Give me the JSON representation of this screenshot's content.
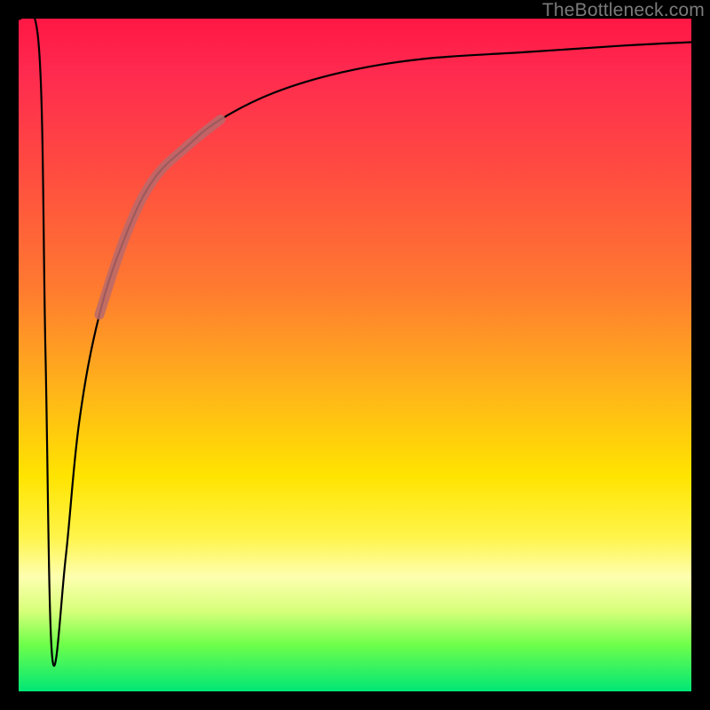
{
  "watermark": "TheBottleneck.com",
  "chart_data": {
    "type": "line",
    "title": "",
    "xlabel": "",
    "ylabel": "",
    "xlim": [
      0,
      100
    ],
    "ylim": [
      0,
      100
    ],
    "curve": {
      "x": [
        0,
        3,
        4,
        5,
        7,
        9,
        12,
        16,
        20,
        25,
        30,
        38,
        48,
        60,
        75,
        90,
        100
      ],
      "y": [
        100,
        96,
        50,
        5,
        20,
        40,
        56,
        68,
        76,
        81,
        85,
        89,
        92,
        94,
        95,
        96,
        96.5
      ]
    },
    "highlight_segment": {
      "x_start": 16,
      "x_end": 25
    },
    "background_gradient": {
      "direction": "vertical",
      "stops": [
        {
          "pos": 0,
          "color": "#ff1744"
        },
        {
          "pos": 22,
          "color": "#ff4a41"
        },
        {
          "pos": 55,
          "color": "#ffb31a"
        },
        {
          "pos": 77,
          "color": "#fff44a"
        },
        {
          "pos": 100,
          "color": "#00e676"
        }
      ]
    }
  }
}
